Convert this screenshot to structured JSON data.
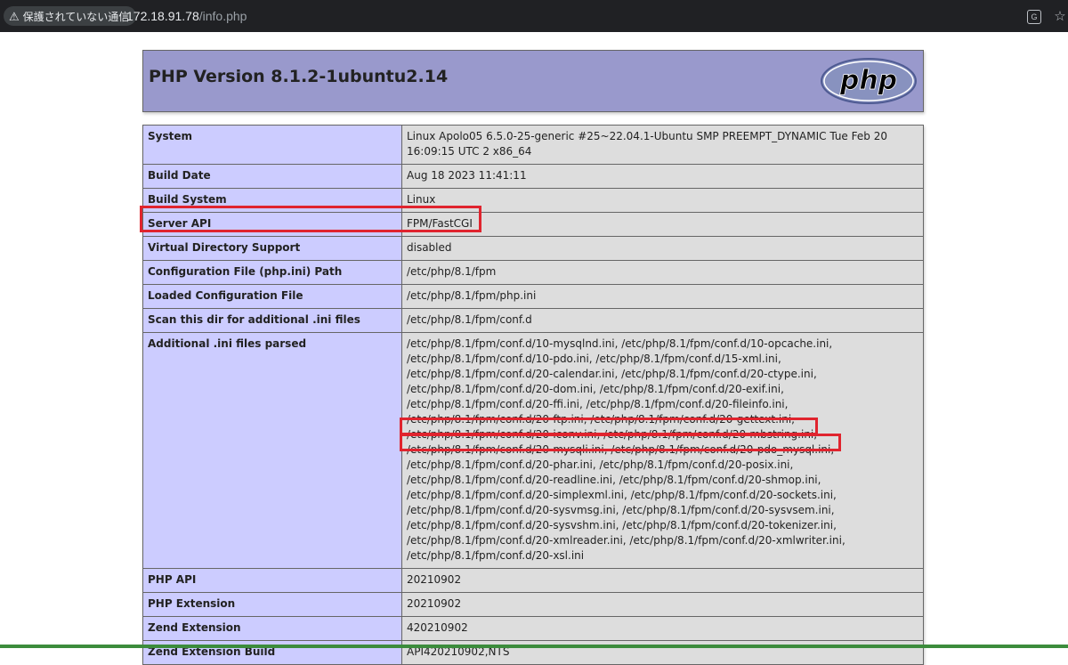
{
  "browser": {
    "security_label": "保護されていない通信",
    "url_host": "172.18.91.78",
    "url_path": "/info.php",
    "icons": [
      "warning-icon",
      "translate-icon",
      "star-icon"
    ]
  },
  "page": {
    "title": "PHP Version 8.1.2-1ubuntu2.14",
    "logo_text": "php"
  },
  "rows": [
    {
      "key": "System",
      "value": "Linux Apolo05 6.5.0-25-generic #25~22.04.1-Ubuntu SMP PREEMPT_DYNAMIC Tue Feb 20 16:09:15 UTC 2 x86_64"
    },
    {
      "key": "Build Date",
      "value": "Aug 18 2023 11:41:11"
    },
    {
      "key": "Build System",
      "value": "Linux"
    },
    {
      "key": "Server API",
      "value": "FPM/FastCGI"
    },
    {
      "key": "Virtual Directory Support",
      "value": "disabled"
    },
    {
      "key": "Configuration File (php.ini) Path",
      "value": "/etc/php/8.1/fpm"
    },
    {
      "key": "Loaded Configuration File",
      "value": "/etc/php/8.1/fpm/php.ini"
    },
    {
      "key": "Scan this dir for additional .ini files",
      "value": "/etc/php/8.1/fpm/conf.d"
    },
    {
      "key": "Additional .ini files parsed",
      "lines": [
        "/etc/php/8.1/fpm/conf.d/10-mysqlnd.ini, /etc/php/8.1/fpm/conf.d/10-opcache.ini,",
        "/etc/php/8.1/fpm/conf.d/10-pdo.ini, /etc/php/8.1/fpm/conf.d/15-xml.ini,",
        "/etc/php/8.1/fpm/conf.d/20-calendar.ini, /etc/php/8.1/fpm/conf.d/20-ctype.ini,",
        "/etc/php/8.1/fpm/conf.d/20-dom.ini, /etc/php/8.1/fpm/conf.d/20-exif.ini,",
        "/etc/php/8.1/fpm/conf.d/20-ffi.ini, /etc/php/8.1/fpm/conf.d/20-fileinfo.ini,",
        "/etc/php/8.1/fpm/conf.d/20-ftp.ini, /etc/php/8.1/fpm/conf.d/20-gettext.ini,",
        "/etc/php/8.1/fpm/conf.d/20-iconv.ini, /etc/php/8.1/fpm/conf.d/20-mbstring.ini,",
        "/etc/php/8.1/fpm/conf.d/20-mysqli.ini, /etc/php/8.1/fpm/conf.d/20-pdo_mysql.ini,",
        "/etc/php/8.1/fpm/conf.d/20-phar.ini, /etc/php/8.1/fpm/conf.d/20-posix.ini,",
        "/etc/php/8.1/fpm/conf.d/20-readline.ini, /etc/php/8.1/fpm/conf.d/20-shmop.ini,",
        "/etc/php/8.1/fpm/conf.d/20-simplexml.ini, /etc/php/8.1/fpm/conf.d/20-sockets.ini,",
        "/etc/php/8.1/fpm/conf.d/20-sysvmsg.ini, /etc/php/8.1/fpm/conf.d/20-sysvsem.ini,",
        "/etc/php/8.1/fpm/conf.d/20-sysvshm.ini, /etc/php/8.1/fpm/conf.d/20-tokenizer.ini,",
        "/etc/php/8.1/fpm/conf.d/20-xmlreader.ini, /etc/php/8.1/fpm/conf.d/20-xmlwriter.ini,",
        "/etc/php/8.1/fpm/conf.d/20-xsl.ini"
      ]
    },
    {
      "key": "PHP API",
      "value": "20210902"
    },
    {
      "key": "PHP Extension",
      "value": "20210902"
    },
    {
      "key": "Zend Extension",
      "value": "420210902"
    },
    {
      "key": "Zend Extension Build",
      "value": "API420210902,NTS"
    }
  ],
  "colors": {
    "header_bg": "#9999cc",
    "key_bg": "#ccccff",
    "value_bg": "#dddddd",
    "highlight": "#e0242e"
  }
}
